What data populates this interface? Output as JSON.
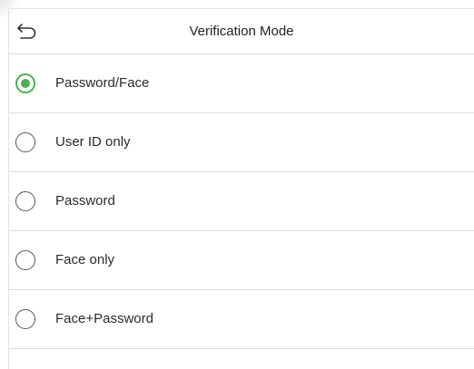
{
  "header": {
    "title": "Verification Mode",
    "back_icon": "back-arrow-icon"
  },
  "options": [
    {
      "label": "Password/Face",
      "selected": true
    },
    {
      "label": "User ID only",
      "selected": false
    },
    {
      "label": "Password",
      "selected": false
    },
    {
      "label": "Face only",
      "selected": false
    },
    {
      "label": "Face+Password",
      "selected": false
    }
  ],
  "colors": {
    "accent": "#4cb050",
    "text": "#2a2a2a",
    "divider": "#dcdcdc"
  }
}
